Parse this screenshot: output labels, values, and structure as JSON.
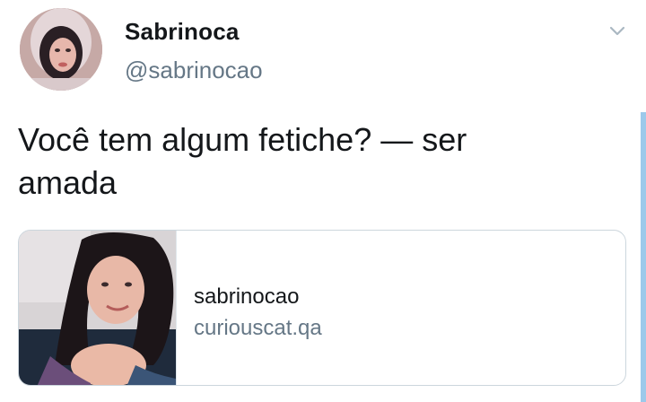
{
  "tweet": {
    "author": {
      "display_name": "Sabrinoca",
      "handle": "@sabrinocao"
    },
    "text": "Você tem algum fetiche? — ser amada",
    "card": {
      "title": "sabrinocao",
      "domain": "curiouscat.qa"
    }
  },
  "icons": {
    "menu": "chevron-down-icon"
  },
  "colors": {
    "text_primary": "#14171a",
    "text_secondary": "#657786",
    "border": "#ccd6dd",
    "scroll_indicator": "#9cc9ea"
  }
}
